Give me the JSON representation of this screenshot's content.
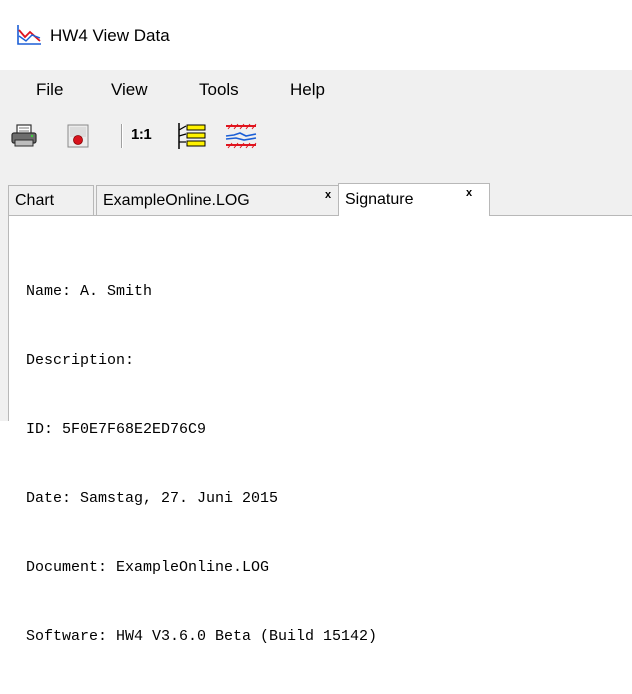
{
  "window": {
    "title": "HW4 View Data"
  },
  "menu": {
    "items": [
      "File",
      "View",
      "Tools",
      "Help"
    ]
  },
  "toolbar": {
    "zoom_ratio_label": "1:1"
  },
  "tabs": [
    {
      "label": "Chart",
      "active": false,
      "closable": false
    },
    {
      "label": "ExampleOnline.LOG",
      "active": false,
      "closable": true
    },
    {
      "label": "Signature",
      "active": true,
      "closable": true
    }
  ],
  "close_glyph": "x",
  "signature": {
    "lines": [
      "Name: A. Smith",
      "Description:",
      "ID: 5F0E7F68E2ED76C9",
      "Date: Samstag, 27. Juni 2015",
      "Document: ExampleOnline.LOG",
      "Software: HW4 V3.6.0 Beta (Build 15142)"
    ]
  },
  "colors": {
    "accent_blue": "#1c5fd6",
    "accent_red": "#e0141e",
    "highlight_yellow": "#fff200"
  }
}
